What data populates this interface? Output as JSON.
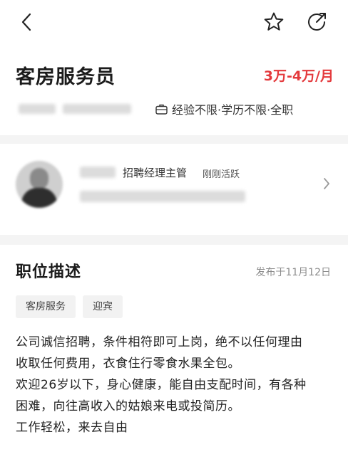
{
  "job": {
    "title": "客房服务员",
    "salary": "3万-4万/月",
    "requirements": "经验不限·学历不限·全职"
  },
  "recruiter": {
    "role": "招聘经理主管",
    "status": "刚刚活跃"
  },
  "description": {
    "heading": "职位描述",
    "published": "发布于11月12日",
    "tags": [
      "客房服务",
      "迎宾"
    ],
    "lines": [
      "公司诚信招聘，条件相符即可上岗，绝不以任何理由",
      "收取任何费用，衣食住行零食水果全包。",
      "欢迎26岁以下，身心健康，能自由支配时间，有各种",
      "困难，向往高收入的姑娘来电或投简历。",
      "工作轻松，来去自由"
    ]
  },
  "icons": {
    "back": "chevron-left-icon",
    "favorite": "star-icon",
    "share": "share-icon",
    "briefcase": "briefcase-icon",
    "more": "chevron-right-icon"
  },
  "colors": {
    "salary": "#e4393c",
    "divider": "#f4f4f4",
    "tag_bg": "#f2f2f2"
  }
}
